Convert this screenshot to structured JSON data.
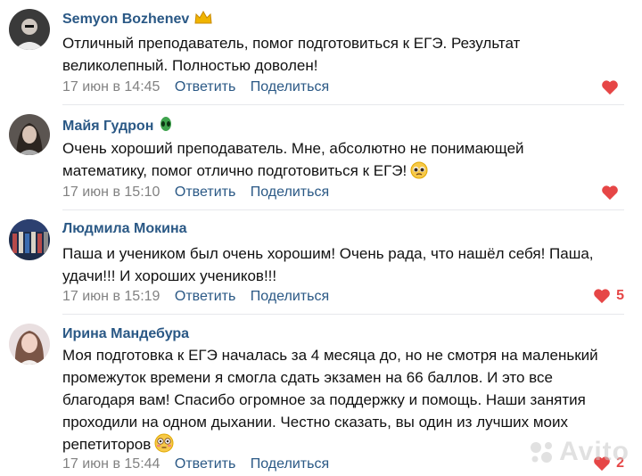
{
  "comments": [
    {
      "author": "Semyon Bozhenev",
      "badge": "crown-icon",
      "text": "Отличный преподаватель, помог подготовиться к ЕГЭ. Результат\nвеликолепный. Полностью доволен!",
      "date": "17 июн в 14:45",
      "reply": "Ответить",
      "share": "Поделиться",
      "likes": ""
    },
    {
      "author": "Майя Гудрон",
      "badge": "alien-icon",
      "text": "Очень хороший преподаватель. Мне, абсолютно не понимающей\nматематику, помог отлично подготовиться к ЕГЭ!",
      "emoji": "pleading-face-emoji",
      "date": "17 июн в 15:10",
      "reply": "Ответить",
      "share": "Поделиться",
      "likes": ""
    },
    {
      "author": "Людмила Мокина",
      "text": "Паша и учеником был очень хорошим! Очень рада, что нашёл себя! Паша,\nудачи!!! И хороших учеников!!!",
      "date": "17 июн в 15:19",
      "reply": "Ответить",
      "share": "Поделиться",
      "likes": "5"
    },
    {
      "author": "Ирина Мандебура",
      "text": "Моя подготовка к ЕГЭ началась за 4 месяца до, но не смотря на маленький\nпромежуток времени я смогла сдать экзамен на 66 баллов. И это все\nблагодаря вам! Спасибо огромное за поддержку и помощь. Наши занятия\nпроходили на одном дыхании. Честно сказать, вы один из лучших моих\nрепетиторов",
      "emoji": "flushed-face-emoji",
      "date": "17 июн в 15:44",
      "reply": "Ответить",
      "share": "Поделиться",
      "likes": "2"
    }
  ],
  "watermark": "Avito",
  "colors": {
    "link": "#2a5885",
    "meta": "#828282",
    "like": "#e64646",
    "divider": "#e7e8ec"
  }
}
